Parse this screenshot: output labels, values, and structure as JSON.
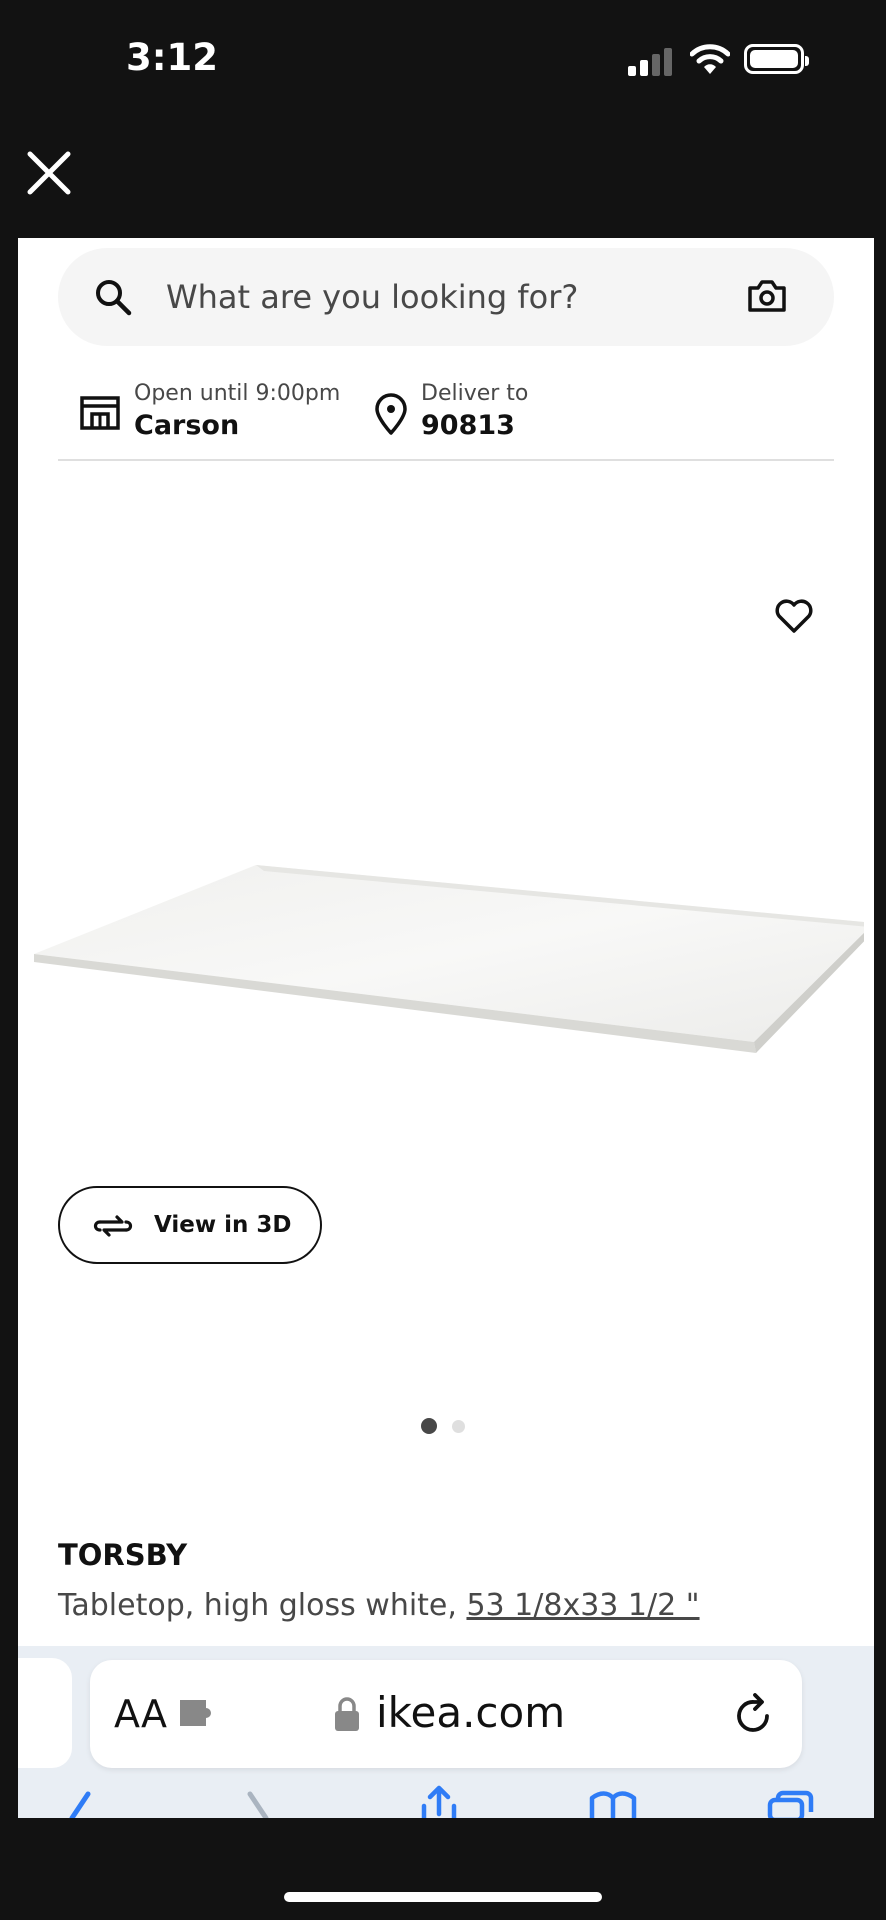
{
  "status_bar": {
    "time": "3:12"
  },
  "search": {
    "placeholder": "What are you looking for?"
  },
  "store": {
    "hours": "Open until 9:00pm",
    "name": "Carson"
  },
  "delivery": {
    "label": "Deliver to",
    "zip": "90813"
  },
  "gallery": {
    "view_3d_label": "View in 3D",
    "page_count": 2,
    "active_page": 1
  },
  "product": {
    "name": "TORSBY",
    "description_prefix": "Tabletop, high gloss white, ",
    "dimensions": "53 1/8x33 1/2 \""
  },
  "browser": {
    "aa_label": "AA",
    "domain": "ikea.com"
  },
  "icons": [
    "close-icon",
    "search-icon",
    "camera-icon",
    "store-icon",
    "location-pin-icon",
    "heart-icon",
    "rotate-3d-icon",
    "extension-icon",
    "lock-icon",
    "reload-icon",
    "back-icon",
    "forward-icon",
    "share-icon",
    "bookmarks-icon",
    "tabs-icon"
  ],
  "colors": {
    "background": "#121212",
    "text": "#111111",
    "muted_text": "#484848",
    "search_bg": "#f5f5f5"
  }
}
